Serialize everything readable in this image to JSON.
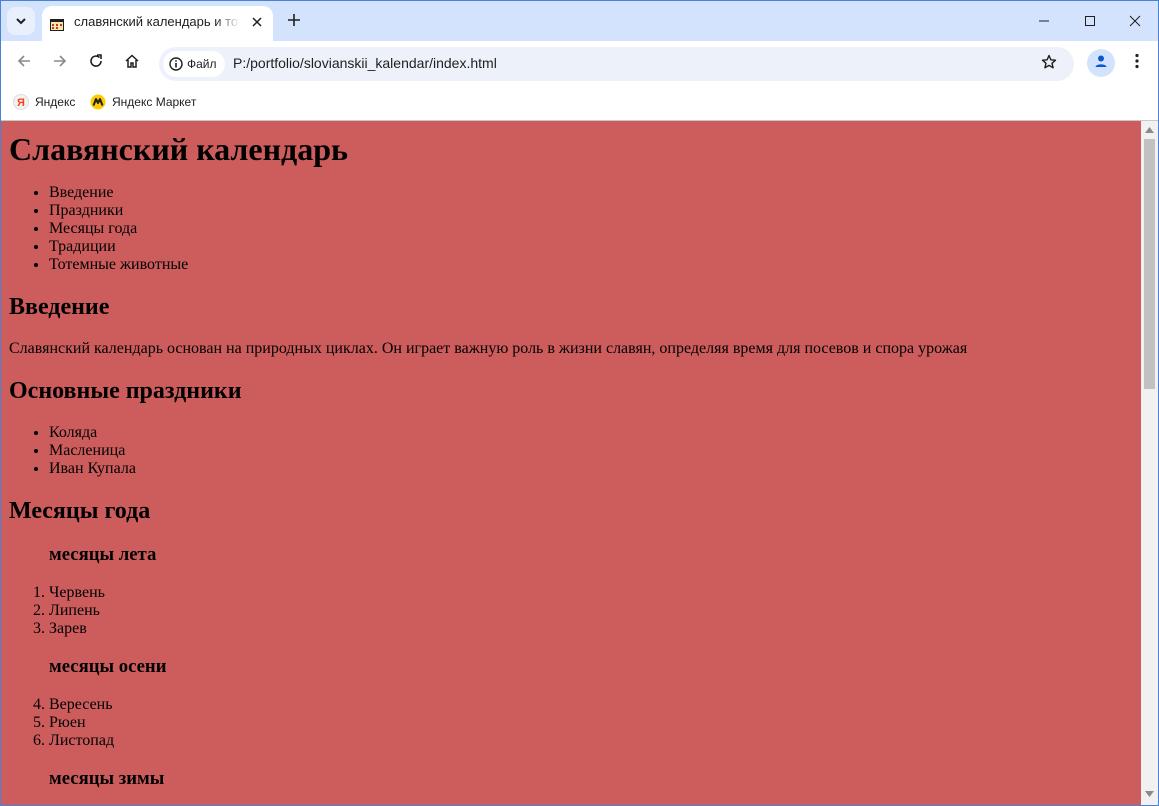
{
  "browser": {
    "tab_title": "славянский календарь и тотемные животные",
    "omnibox_chip": "Файл",
    "url": "P:/portfolio/slovianskii_kalendar/index.html",
    "bookmarks": [
      "Яндекс",
      "Яндекс Маркет"
    ],
    "accent": "#d3e3fd"
  },
  "page": {
    "background": "#cd5c5c",
    "title": "Славянский календарь",
    "nav": [
      "Введение",
      "Праздники",
      "Месяцы года",
      "Традиции",
      "Тотемные животные"
    ],
    "intro_heading": "Введение",
    "intro_text": "Славянский календарь основан на природных циклах. Он играет важную роль в жизни славян, определяя время для посевов и спора урожая",
    "holidays_heading": "Основные праздники",
    "holidays": [
      "Коляда",
      "Масленица",
      "Иван Купала"
    ],
    "months_heading": "Месяцы года",
    "summer_heading": "месяцы лета",
    "summer": [
      "Червень",
      "Липень",
      "Зарев"
    ],
    "autumn_heading": "месяцы осени",
    "autumn": [
      "Вересень",
      "Рюен",
      "Листопад"
    ],
    "winter_heading": "месяцы зимы"
  }
}
